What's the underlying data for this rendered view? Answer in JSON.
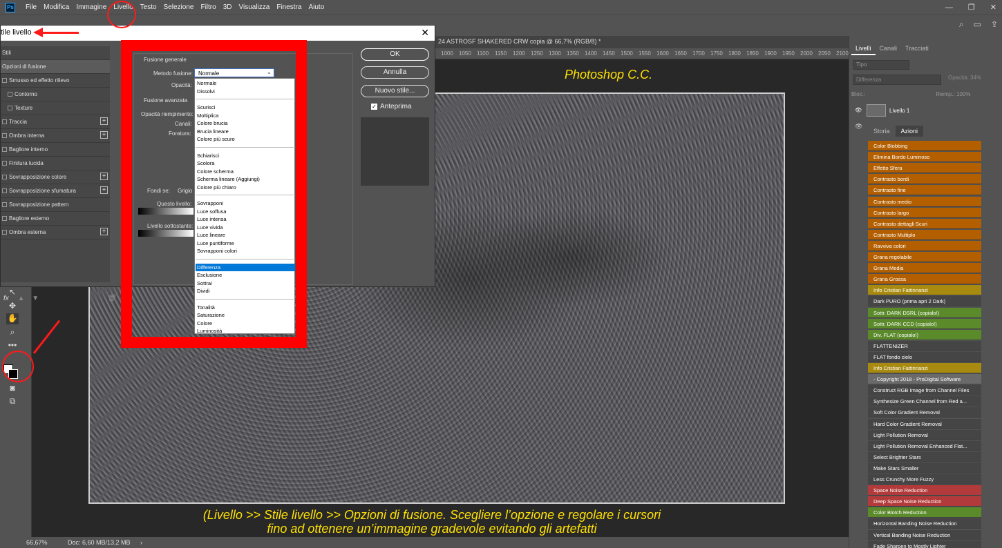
{
  "menu": [
    "File",
    "Modifica",
    "Immagine",
    "Livello",
    "Testo",
    "Selezione",
    "Filtro",
    "3D",
    "Visualizza",
    "Finestra",
    "Aiuto"
  ],
  "logo": "Ps",
  "window_controls": {
    "min": "—",
    "max": "❐",
    "close": "✕"
  },
  "doc_tab": "24 ASTROSF SHAKERED CRW copia @ 66,7% (RGB/8) *",
  "ruler_ticks": [
    "1000",
    "1050",
    "1100",
    "1150",
    "1200",
    "1250",
    "1300",
    "1350",
    "1400",
    "1450",
    "1500",
    "1550",
    "1600",
    "1650",
    "1700",
    "1750",
    "1800",
    "1850",
    "1900",
    "1950",
    "2000",
    "2050",
    "2100"
  ],
  "dialog": {
    "title": "tile livello",
    "close": "✕",
    "stili_header": "Stili",
    "stili": [
      {
        "label": "Opzioni di fusione",
        "check": false,
        "plus": false,
        "selected": true
      },
      {
        "label": "Smusso ed effetto rilievo",
        "check": true,
        "plus": false
      },
      {
        "label": "Contorno",
        "check": true,
        "plus": false,
        "indent": true
      },
      {
        "label": "Texture",
        "check": true,
        "plus": false,
        "indent": true
      },
      {
        "label": "Traccia",
        "check": true,
        "plus": true
      },
      {
        "label": "Ombra interna",
        "check": true,
        "plus": true
      },
      {
        "label": "Bagliore interno",
        "check": true,
        "plus": false
      },
      {
        "label": "Finitura lucida",
        "check": true,
        "plus": false
      },
      {
        "label": "Sovrapposizione colore",
        "check": true,
        "plus": true
      },
      {
        "label": "Sovrapposizione sfumatura",
        "check": true,
        "plus": true
      },
      {
        "label": "Sovrapposizione pattern",
        "check": true,
        "plus": false
      },
      {
        "label": "Bagliore esterno",
        "check": true,
        "plus": false
      },
      {
        "label": "Ombra esterna",
        "check": true,
        "plus": true
      }
    ],
    "fx": "fx",
    "fusione_generale": "Fusione generale",
    "metodo_label": "Metodo fusione:",
    "metodo_value": "Normale",
    "opacita_label": "Opacità:",
    "fusione_avanzata": "Fusione avanzata",
    "opacita_riemp": "Opacità riempimento:",
    "canali": "Canali:",
    "foratura": "Foratura:",
    "fondi_se": "Fondi se:",
    "fondi_val": "Grigio",
    "questo_livello": "Questo livello:",
    "livello_sott": "Livello sottostante:",
    "ok": "OK",
    "annulla": "Annulla",
    "nuovo_stile": "Nuovo stile...",
    "anteprima": "Anteprima",
    "checkmark": "✓",
    "dropdown_groups": [
      [
        "Normale",
        "Dissolvi"
      ],
      [
        "Scurisci",
        "Moltiplica",
        "Colore brucia",
        "Brucia lineare",
        "Colore più scuro"
      ],
      [
        "Schiarisci",
        "Scolora",
        "Colore scherma",
        "Scherma lineare (Aggiungi)",
        "Colore più chiaro"
      ],
      [
        "Sovrapponi",
        "Luce soffusa",
        "Luce intensa",
        "Luce vivida",
        "Luce lineare",
        "Luce puntiforme",
        "Sovrapponi colori"
      ],
      [
        "Differenza",
        "Esclusione",
        "Sottrai",
        "Dividi"
      ],
      [
        "Tonalità",
        "Saturazione",
        "Colore",
        "Luminosità"
      ]
    ],
    "dropdown_selected": "Differenza"
  },
  "overlay": {
    "title": "Photoshop C.C.",
    "caption_line1": "(Livello >> Stile livello >> Opzioni di fusione. Scegliere l’opzione e regolare i cursori",
    "caption_line2": "fino ad ottenere un’immagine gradevole evitando gli artefatti"
  },
  "status": {
    "zoom": "66,67%",
    "doc": "Doc: 6,60 MB/13,2 MB",
    "arrow": "›"
  },
  "layers_panel": {
    "tabs": [
      "Livelli",
      "Canali",
      "Tracciati"
    ],
    "search": "Tipo",
    "blend": "Differenza",
    "opacity": "Opacità: 34%",
    "bloc": "Bloc.:",
    "fill": "Riemp.: 100%",
    "layer_name": "Livello 1"
  },
  "actions_panel": {
    "tabs": [
      "Storia",
      "Azioni"
    ],
    "items": [
      {
        "label": "Color Blobbing",
        "color": "#b35f00"
      },
      {
        "label": "Elimina Bordo Luminoso",
        "color": "#b35f00"
      },
      {
        "label": "Effetto Sfera",
        "color": "#b35f00"
      },
      {
        "label": "Contrasto bordi",
        "color": "#b35f00"
      },
      {
        "label": "Contrasto fine",
        "color": "#b35f00"
      },
      {
        "label": "Contrasto medio",
        "color": "#b35f00"
      },
      {
        "label": "Contrasto largo",
        "color": "#b35f00"
      },
      {
        "label": "Contrasto dettagli Scuri",
        "color": "#b35f00"
      },
      {
        "label": "Contrasto Multiplo",
        "color": "#b35f00"
      },
      {
        "label": "Ravviva colori",
        "color": "#b35f00"
      },
      {
        "label": "Grana regolabile",
        "color": "#b35f00"
      },
      {
        "label": "Grana Media",
        "color": "#b35f00"
      },
      {
        "label": "Grana Grossa",
        "color": "#b35f00"
      },
      {
        "label": "Info Cristian Fattinnanzi",
        "color": "#a88a10"
      },
      {
        "label": "Dark PURO (prima apri 2 Dark)",
        "color": "#454545"
      },
      {
        "label": "Sottr. DARK DSRL (copialo!)",
        "color": "#5a8a2a"
      },
      {
        "label": "Sottr. DARK CCD (copialo!)",
        "color": "#5a8a2a"
      },
      {
        "label": "Div. FLAT (copialo!)",
        "color": "#5a8a2a"
      },
      {
        "label": "FLATTENIZER",
        "color": "#454545"
      },
      {
        "label": "FLAT fondo cielo",
        "color": "#454545"
      },
      {
        "label": "Info Cristian Fattinnanzi",
        "color": "#a88a10"
      },
      {
        "label": "- Copyright 2018 - ProDigital Software",
        "color": "#6a6a6a"
      },
      {
        "label": "Construct RGB Image from Channel Files",
        "color": "#454545"
      },
      {
        "label": "Synthesize Green Channel from Red a...",
        "color": "#454545"
      },
      {
        "label": "Soft Color Gradient Removal",
        "color": "#454545"
      },
      {
        "label": "Hard Color Gradient Removal",
        "color": "#454545"
      },
      {
        "label": "Light Pollution Removal",
        "color": "#454545"
      },
      {
        "label": "Light Pollution Removal Enhanced Flat...",
        "color": "#454545"
      },
      {
        "label": "Select Brighter Stars",
        "color": "#454545"
      },
      {
        "label": "Make Stars Smaller",
        "color": "#454545"
      },
      {
        "label": "Less Crunchy More Fuzzy",
        "color": "#454545"
      },
      {
        "label": "Space Noise Reduction",
        "color": "#b33a3a"
      },
      {
        "label": "Deep Space Noise Reduction",
        "color": "#b33a3a"
      },
      {
        "label": "Color Blotch Reduction",
        "color": "#5a8a2a"
      },
      {
        "label": "Horizontal Banding Noise Reduction",
        "color": "#454545"
      },
      {
        "label": "Vertical Banding Noise Reduction",
        "color": "#454545"
      },
      {
        "label": "Fade Sharpen to Mostly Lighter",
        "color": "#454545"
      }
    ]
  }
}
